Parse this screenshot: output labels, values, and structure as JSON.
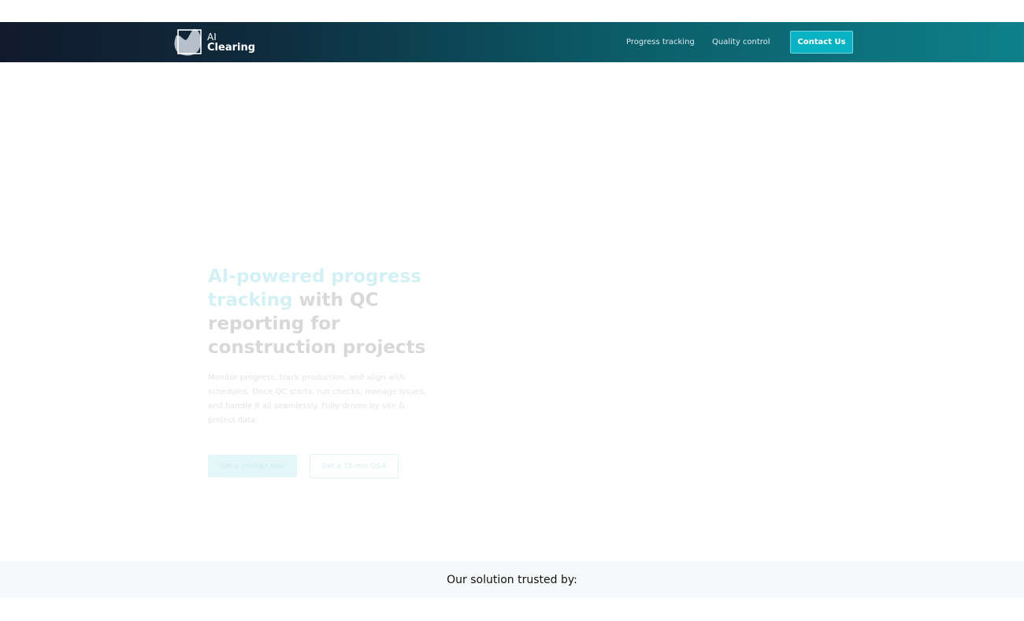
{
  "header": {
    "logo": {
      "line1": "AI",
      "line2": "Clearing"
    },
    "nav": [
      {
        "label": "Progress tracking"
      },
      {
        "label": "Quality control"
      }
    ],
    "contact_label": "Contact Us"
  },
  "hero": {
    "title_accent": "AI-powered progress tracking",
    "title_rest": " with QC reporting for construction projects",
    "description": "Monitor progress, track production, and align with schedules. Once QC starts, run checks, manage issues, and handle it all seamlessly. Fully driven by site & project data.",
    "primary_cta": "Get a product tour",
    "secondary_cta": "Get a 15-min Q&A"
  },
  "trusted": {
    "label": "Our solution trusted by:"
  },
  "colors": {
    "accent": "#0ab1c3",
    "header_dark": "#111a2c",
    "header_teal": "#0e8089"
  },
  "icons": {
    "logo": "ai-clearing-logo-icon"
  }
}
